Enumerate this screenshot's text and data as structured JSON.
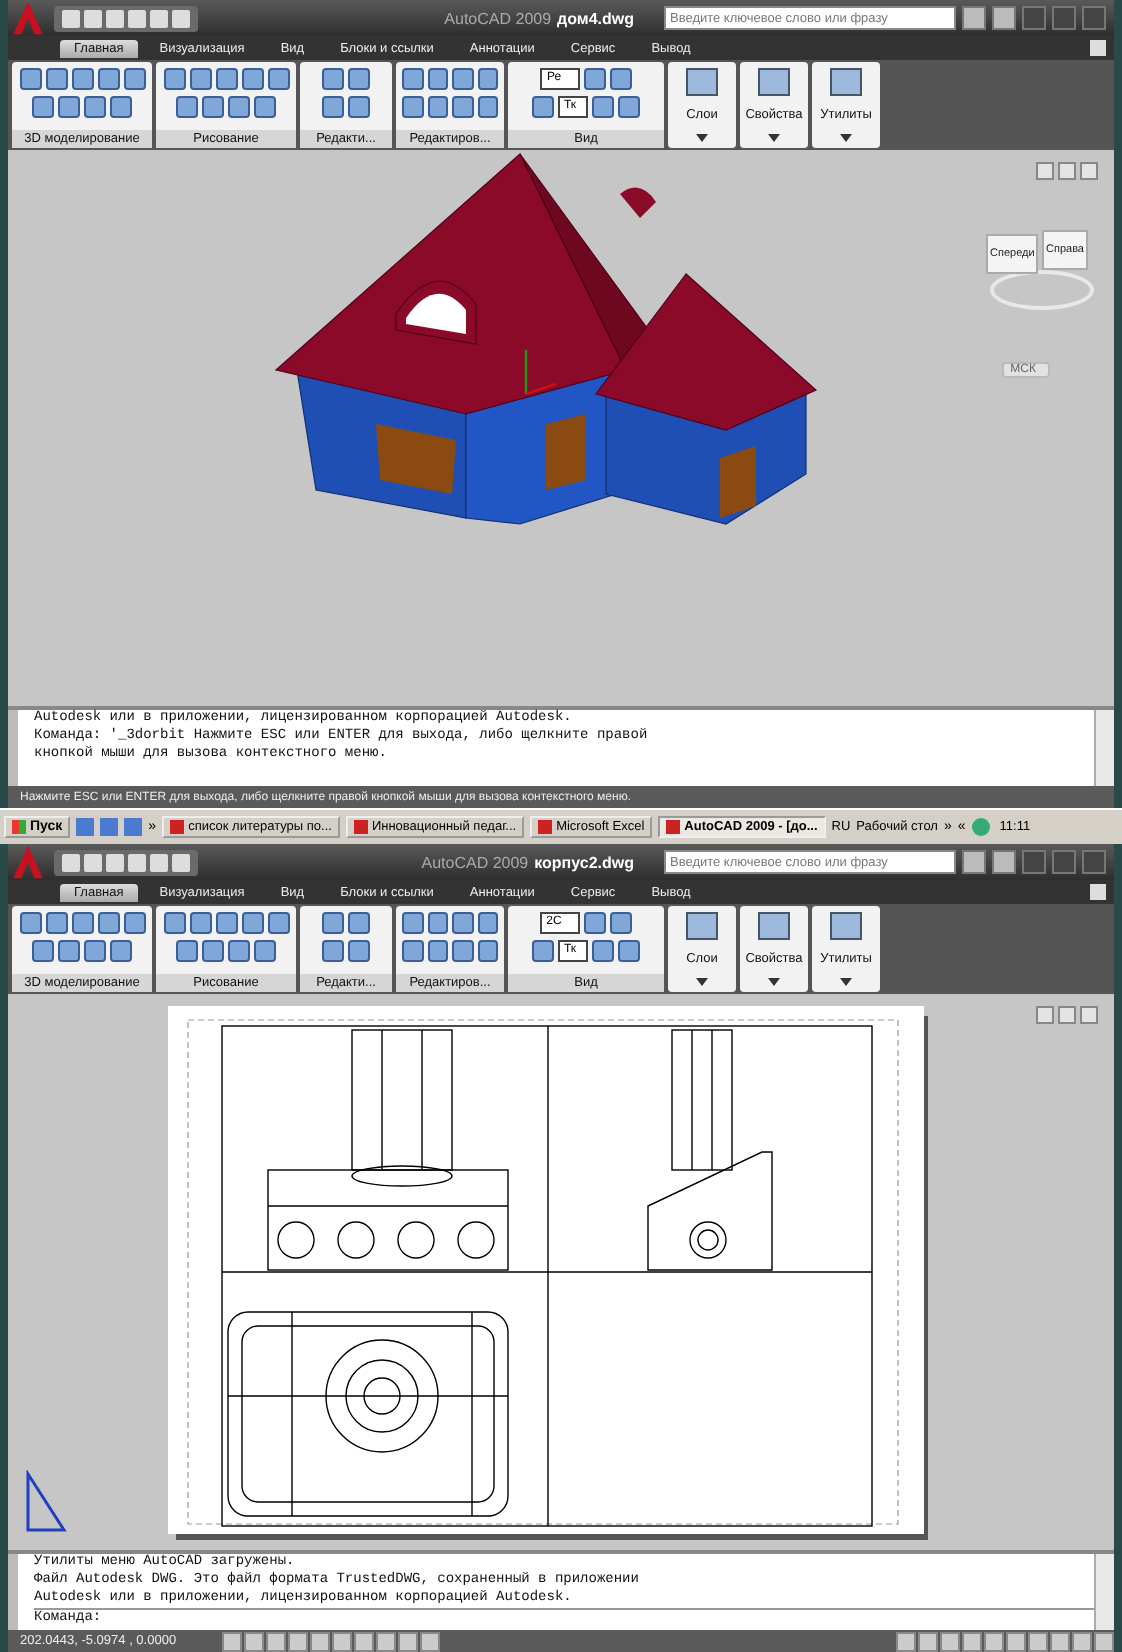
{
  "windows": [
    {
      "app": "AutoCAD 2009",
      "file": "дом4.dwg",
      "search": {
        "placeholder": "Введите ключевое слово или фразу"
      },
      "tabs": [
        {
          "label": "Главная",
          "selected": true
        },
        {
          "label": "Визуализация",
          "selected": false
        },
        {
          "label": "Вид",
          "selected": false
        },
        {
          "label": "Блоки и ссылки",
          "selected": false
        },
        {
          "label": "Аннотации",
          "selected": false
        },
        {
          "label": "Сервис",
          "selected": false
        },
        {
          "label": "Вывод",
          "selected": false
        }
      ],
      "panels": [
        {
          "label": "3D моделирование"
        },
        {
          "label": "Рисование"
        },
        {
          "label": "Редакти..."
        },
        {
          "label": "Редактиров..."
        },
        {
          "label": "Вид"
        }
      ],
      "view_combos": [
        "Ре",
        "Тк"
      ],
      "big_buttons": [
        {
          "label": "Слои"
        },
        {
          "label": "Свойства"
        },
        {
          "label": "Утилиты"
        }
      ],
      "viewport": {
        "kind": "model",
        "cube_faces": [
          "Спереди",
          "Справа"
        ],
        "ucs_label": "МСК"
      },
      "command_lines": [
        "Autodesk или в приложении, лицензированном корпорацией Autodesk.",
        "Команда: '_3dorbit Нажмите ESC или ENTER для выхода, либо щелкните правой",
        "кнопкой мыши для вызова контекстного меню."
      ],
      "status": {
        "kind": "message",
        "text": "Нажмите ESC или ENTER для выхода, либо щелкните правой кнопкой мыши для вызова контекстного меню."
      }
    },
    {
      "app": "AutoCAD 2009",
      "file": "корпус2.dwg",
      "search": {
        "placeholder": "Введите ключевое слово или фразу"
      },
      "tabs": [
        {
          "label": "Главная",
          "selected": true
        },
        {
          "label": "Визуализация",
          "selected": false
        },
        {
          "label": "Вид",
          "selected": false
        },
        {
          "label": "Блоки и ссылки",
          "selected": false
        },
        {
          "label": "Аннотации",
          "selected": false
        },
        {
          "label": "Сервис",
          "selected": false
        },
        {
          "label": "Вывод",
          "selected": false
        }
      ],
      "panels": [
        {
          "label": "3D моделирование"
        },
        {
          "label": "Рисование"
        },
        {
          "label": "Редакти..."
        },
        {
          "label": "Редактиров..."
        },
        {
          "label": "Вид"
        }
      ],
      "view_combos": [
        "2С",
        "Тк"
      ],
      "big_buttons": [
        {
          "label": "Слои"
        },
        {
          "label": "Свойства"
        },
        {
          "label": "Утилиты"
        }
      ],
      "viewport": {
        "kind": "layout"
      },
      "command_lines": [
        "Утилиты меню AutoCAD загружены.",
        "Файл Autodesk DWG. Это файл формата TrustedDWG, сохраненный в приложении",
        "Autodesk или в приложении, лицензированном корпорацией Autodesk."
      ],
      "command_prompt": "Команда:",
      "status": {
        "kind": "coords",
        "text": "202.0443, -5.0974 , 0.0000"
      }
    }
  ],
  "taskbar": {
    "start": "Пуск",
    "quick_more": "»",
    "items": [
      {
        "label": "список литературы по...",
        "selected": false
      },
      {
        "label": "Инновационный педаг...",
        "selected": false
      },
      {
        "label": "Microsoft Excel",
        "selected": false
      },
      {
        "label": "AutoCAD 2009 - [до...",
        "selected": true
      }
    ],
    "language": "RU",
    "desktop": "Рабочий стол",
    "more": "»",
    "collapse": "«",
    "clock": "11:11"
  }
}
